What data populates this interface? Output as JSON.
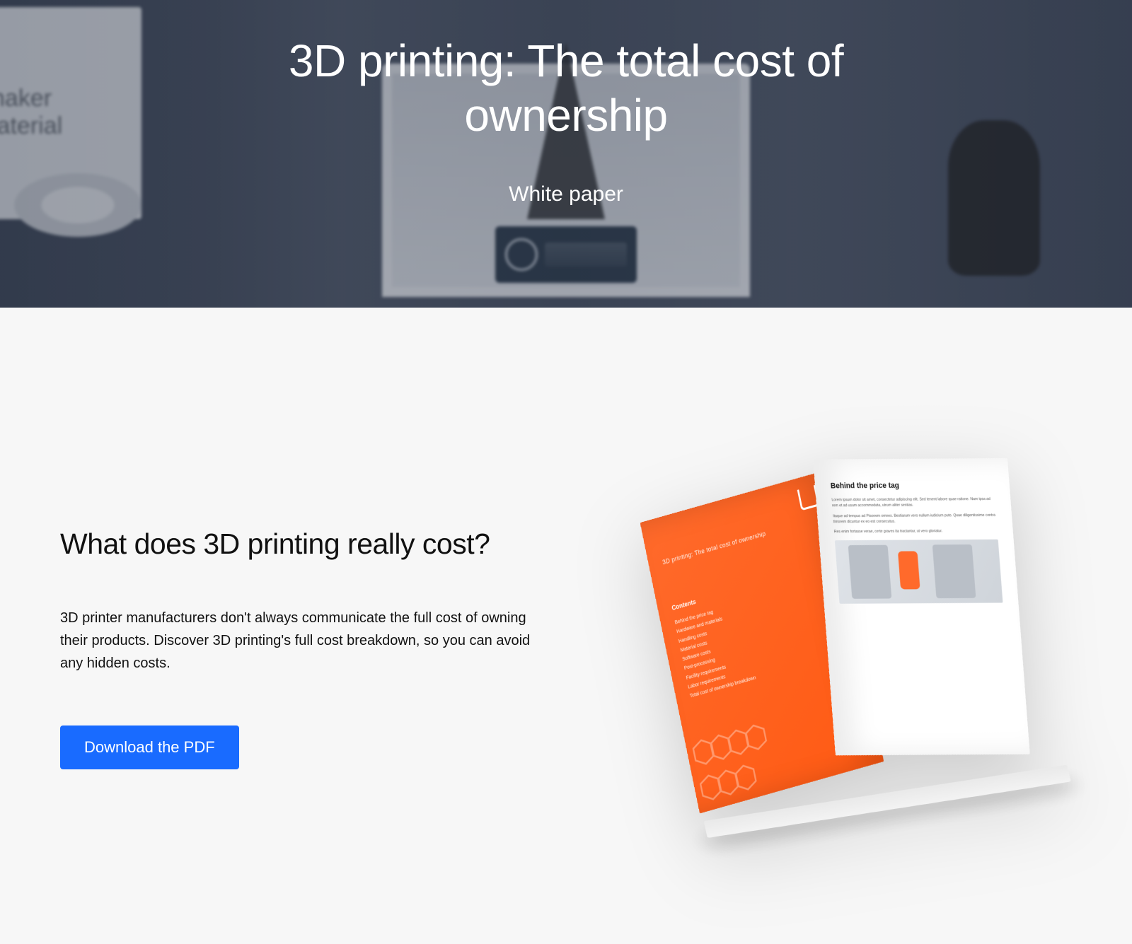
{
  "hero": {
    "title": "3D printing: The total cost of ownership",
    "subtitle": "White paper"
  },
  "section": {
    "heading": "What does 3D printing really cost?",
    "body": "3D printer manufacturers don't always communicate the full cost of owning their products. Discover 3D printing's full cost breakdown, so you can avoid any hidden costs.",
    "cta": "Download the PDF"
  },
  "brochure": {
    "left": {
      "title": "3D printing: The total cost of ownership",
      "section": "Contents",
      "items": [
        "Behind the price tag",
        "Hardware and materials",
        "Handling costs",
        "Material costs",
        "Software costs",
        "Post-processing",
        "Facility requirements",
        "Labor requirements",
        "Total cost of ownership breakdown"
      ]
    },
    "right": {
      "heading": "Behind the price tag"
    }
  },
  "colors": {
    "cta": "#196bff",
    "brochure_orange": "#ff5a13"
  }
}
